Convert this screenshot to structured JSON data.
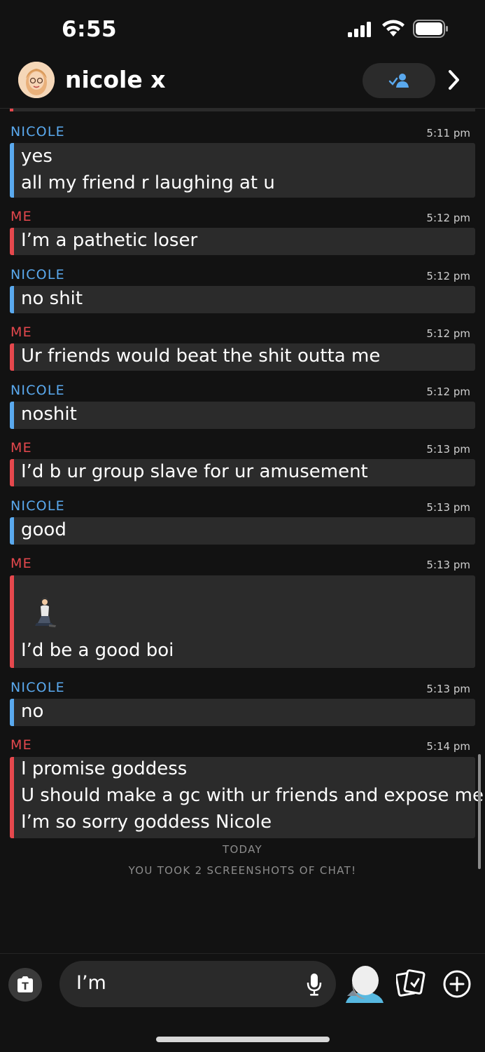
{
  "status": {
    "time": "6:55"
  },
  "header": {
    "name": "nicole x"
  },
  "messages": [
    {
      "sender": "NICOLE",
      "time": "5:11 pm",
      "lines": [
        "yes",
        "all my friend r laughing at u"
      ]
    },
    {
      "sender": "ME",
      "time": "5:12 pm",
      "lines": [
        "I’m a pathetic loser"
      ]
    },
    {
      "sender": "NICOLE",
      "time": "5:12 pm",
      "lines": [
        "no shit"
      ]
    },
    {
      "sender": "ME",
      "time": "5:12 pm",
      "lines": [
        "Ur friends would beat the shit outta me"
      ]
    },
    {
      "sender": "NICOLE",
      "time": "5:12 pm",
      "lines": [
        "noshit"
      ]
    },
    {
      "sender": "ME",
      "time": "5:13 pm",
      "lines": [
        "I’d b ur group slave for ur amusement"
      ]
    },
    {
      "sender": "NICOLE",
      "time": "5:13 pm",
      "lines": [
        "good"
      ]
    },
    {
      "sender": "ME",
      "time": "5:13 pm",
      "emoji": "kneeling-person",
      "lines": [
        "I’d be a good boi"
      ]
    },
    {
      "sender": "NICOLE",
      "time": "5:13 pm",
      "lines": [
        "no"
      ]
    },
    {
      "sender": "ME",
      "time": "5:14 pm",
      "lines": [
        "I promise goddess",
        "U should make a gc with ur friends and expose me",
        "I’m so sorry goddess Nicole"
      ]
    }
  ],
  "footer_notes": {
    "today": "TODAY",
    "notice": "YOU TOOK 2 SCREENSHOTS OF CHAT!"
  },
  "composer": {
    "input_value": "I’m"
  },
  "colors": {
    "nicole": "#5aa9ee",
    "me": "#e5484d",
    "bubble": "#2b2b2b",
    "background": "#121212"
  },
  "icons": [
    "signal-icon",
    "wifi-icon",
    "battery-icon",
    "friend-check-icon",
    "chevron-right-icon",
    "camera-icon",
    "mic-icon",
    "bitmoji-icon",
    "cards-icon",
    "plus-icon"
  ]
}
